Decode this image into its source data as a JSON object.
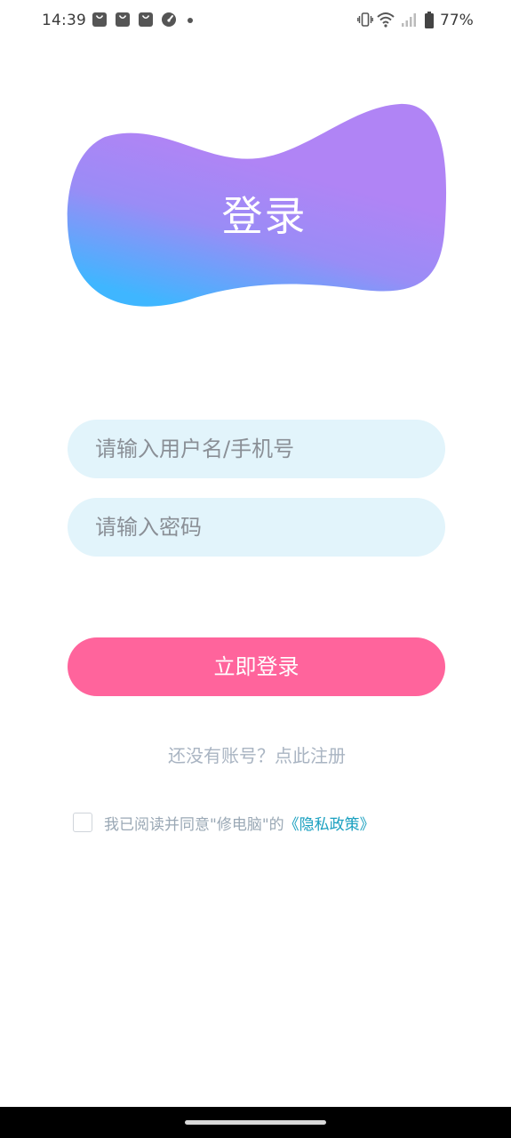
{
  "status_bar": {
    "time": "14:39",
    "battery": "77%",
    "notification_icons": [
      "shopping-bag-icon",
      "shopping-bag-icon",
      "shopping-bag-icon",
      "speedometer-icon",
      "dot-icon"
    ],
    "system_icons": [
      "vibrate-icon",
      "wifi-icon",
      "signal-icon",
      "battery-icon"
    ]
  },
  "header": {
    "title": "登录",
    "gradient_colors": [
      "#b084f5",
      "#3fb6ff"
    ]
  },
  "form": {
    "username_placeholder": "请输入用户名/手机号",
    "password_placeholder": "请输入密码",
    "login_label": "立即登录",
    "register_text": "还没有账号？点此注册"
  },
  "agreement": {
    "checked": false,
    "text": "我已阅读并同意\"修电脑\"的",
    "link_text": "《隐私政策》"
  },
  "colors": {
    "input_bg": "#e2f4fb",
    "button_bg": "#ff649c",
    "link": "#1aa0c0",
    "muted_text": "#a9b4c2"
  }
}
